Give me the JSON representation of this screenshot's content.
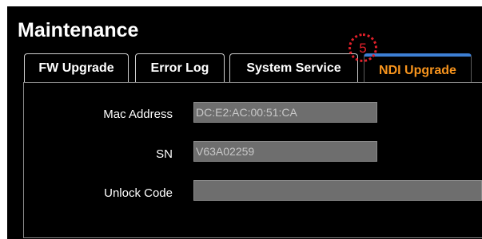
{
  "page": {
    "title": "Maintenance"
  },
  "tabs": {
    "fw_upgrade": "FW Upgrade",
    "error_log": "Error Log",
    "system_service": "System Service",
    "ndi_upgrade": "NDI Upgrade",
    "active": "NDI Upgrade"
  },
  "annotation": {
    "step_number": "5",
    "color": "#e3202a"
  },
  "fields": {
    "mac_address": {
      "label": "Mac Address",
      "value": "DC:E2:AC:00:51:CA"
    },
    "sn": {
      "label": "SN",
      "value": "V63A02259"
    },
    "unlock_code": {
      "label": "Unlock Code",
      "value": ""
    }
  },
  "colors": {
    "active_tab_text": "#f7941d",
    "active_tab_accent": "#3d7fd4",
    "background": "#000000"
  }
}
